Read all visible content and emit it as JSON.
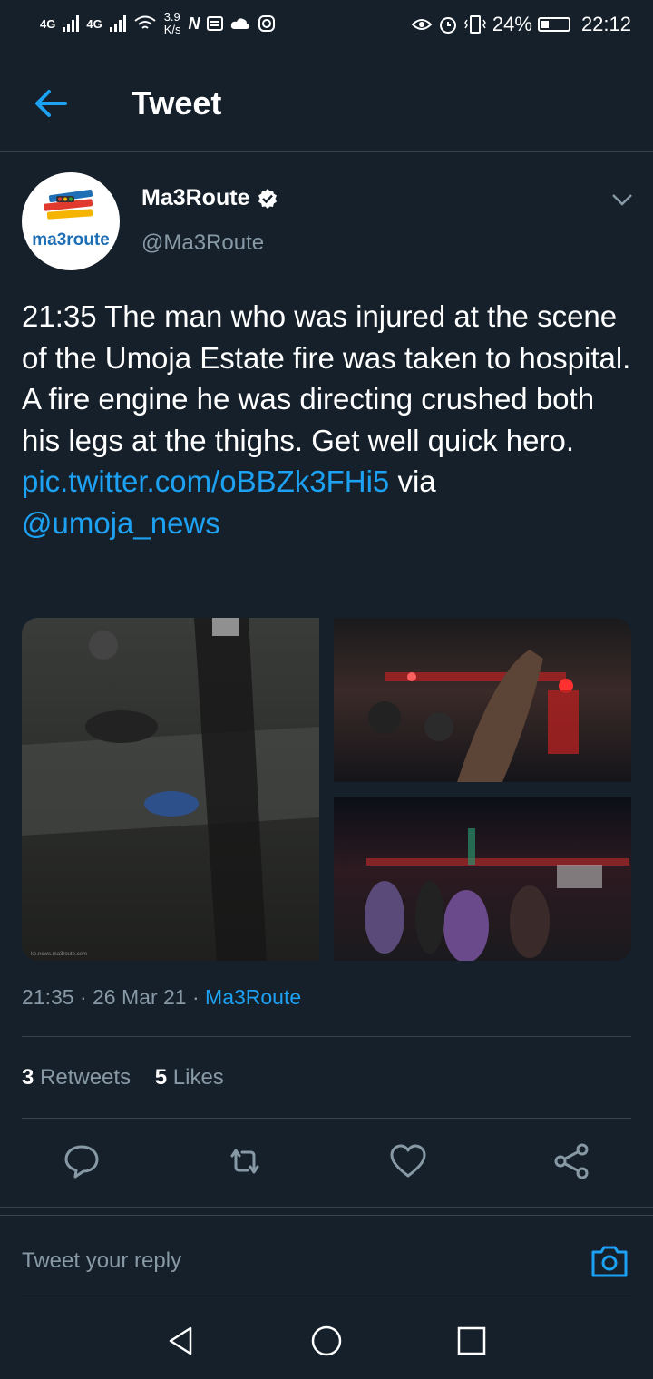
{
  "status_bar": {
    "network1": "4G",
    "network2": "4G",
    "speed_value": "3.9",
    "speed_unit": "K/s",
    "battery": "24%",
    "time": "22:12"
  },
  "header": {
    "title": "Tweet"
  },
  "author": {
    "name": "Ma3Route",
    "handle": "@Ma3Route",
    "avatar_text": "ma3route"
  },
  "tweet": {
    "text_main": "21:35 The man who was injured at the scene of the Umoja Estate fire was taken to hospital. A fire engine he was directing crushed both his legs at the thighs. Get well quick hero.",
    "link": "pic.twitter.com/oBBZk3FHi5",
    "via": "via",
    "mention": "@umoja_news",
    "photo_watermark": "ke.news.ma3route.com"
  },
  "meta": {
    "time": "21:35",
    "date": "26 Mar 21",
    "source": "Ma3Route",
    "sep": "·"
  },
  "stats": {
    "retweets_count": "3",
    "retweets_label": "Retweets",
    "likes_count": "5",
    "likes_label": "Likes"
  },
  "reply": {
    "placeholder": "Tweet your reply"
  },
  "colors": {
    "background": "#15202b",
    "accent": "#1da1f2",
    "muted": "#8899a6",
    "divider": "#38444d"
  }
}
